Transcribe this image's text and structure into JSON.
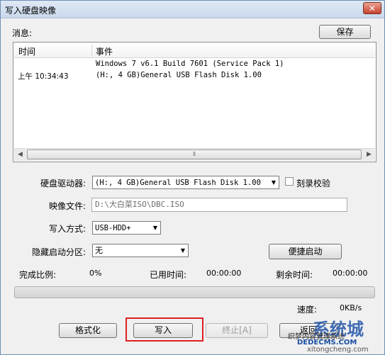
{
  "window": {
    "title": "写入硬盘映像",
    "close_label": "✕"
  },
  "messages": {
    "label": "消息:",
    "save_button": "保存",
    "columns": [
      "时间",
      "事件"
    ],
    "rows": [
      {
        "time": "",
        "event": "Windows 7 v6.1 Build 7601 (Service Pack 1)"
      },
      {
        "time": "上午 10:34:43",
        "event": "(H:, 4 GB)General USB Flash Disk  1.00"
      }
    ],
    "scroll_grip": "⦀"
  },
  "form": {
    "drive_label": "硬盘驱动器:",
    "drive_value": "(H:, 4 GB)General USB Flash Disk  1.00",
    "verify_label": "刻录校验",
    "image_label": "映像文件:",
    "image_value": "D:\\大白菜ISO\\DBC.ISO",
    "method_label": "写入方式:",
    "method_value": "USB-HDD+",
    "hidden_label": "隐藏启动分区:",
    "hidden_value": "无",
    "quick_boot_button": "便捷启动"
  },
  "status": {
    "complete_label": "完成比例:",
    "complete_value": "0%",
    "elapsed_label": "已用时间:",
    "elapsed_value": "00:00:00",
    "remaining_label": "剩余时间:",
    "remaining_value": "00:00:00",
    "progress": 0,
    "speed_label": "速度:",
    "speed_value": "0KB/s"
  },
  "buttons": {
    "format": "格式化",
    "write": "写入",
    "stop": "终止[A]",
    "back": "返回"
  },
  "watermark": {
    "brand": "系统城",
    "line1": "织梦内容管理系统",
    "line2": "DEDECMS.COM",
    "line3": "xitongcheng.com"
  },
  "colors": {
    "highlight": "#e02020",
    "watermark": "#2255aa"
  }
}
